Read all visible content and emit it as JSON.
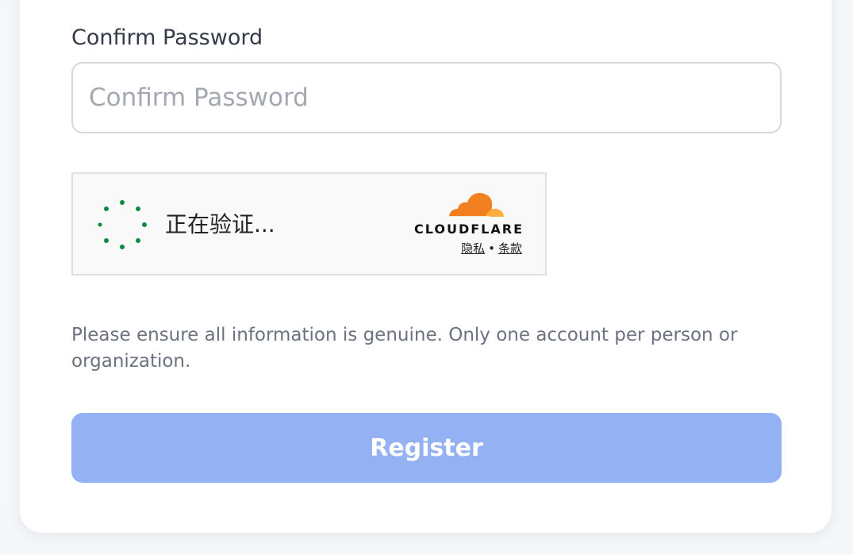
{
  "form": {
    "confirm_password_label": "Confirm Password",
    "confirm_password_placeholder": "Confirm Password",
    "confirm_password_value": ""
  },
  "captcha": {
    "status_text": "正在验证...",
    "brand": "CLOUDFLARE",
    "privacy_link": "隐私",
    "separator": "•",
    "terms_link": "条款",
    "spinner_color": "#0f8a3c",
    "brand_orange": "#f38020",
    "brand_light_orange": "#faae40"
  },
  "notice_text": "Please ensure all information is genuine. Only one account per person or organization.",
  "register": {
    "label": "Register",
    "state": "disabled",
    "color": "#93b1f3"
  }
}
